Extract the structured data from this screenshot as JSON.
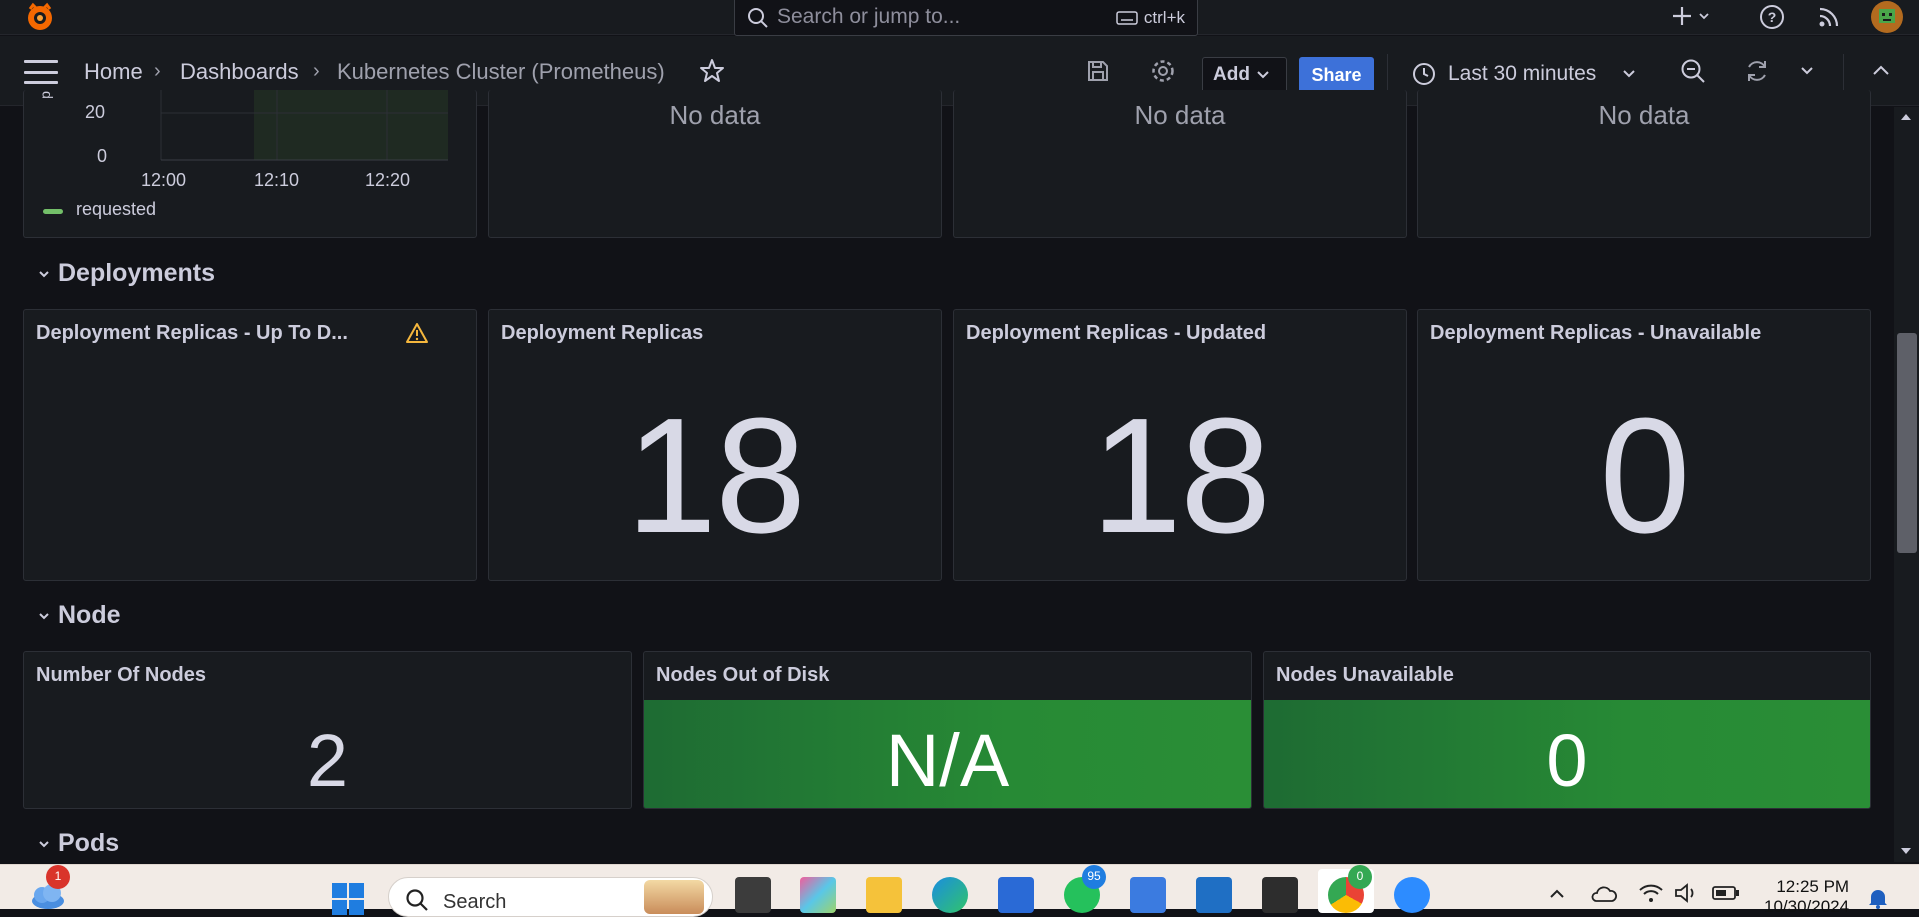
{
  "topbar": {
    "search_placeholder": "Search or jump to...",
    "search_shortcut": "ctrl+k"
  },
  "breadcrumb": {
    "home": "Home",
    "dashboards": "Dashboards",
    "current": "Kubernetes Cluster (Prometheus)"
  },
  "toolbar": {
    "add_label": "Add",
    "share_label": "Share",
    "time_range": "Last 30 minutes"
  },
  "top_row": {
    "chart_y_ticks": [
      "20",
      "0"
    ],
    "chart_x_ticks": [
      "12:00",
      "12:10",
      "12:20"
    ],
    "chart_legend": "requested",
    "no_data_1": "No data",
    "no_data_2": "No data",
    "no_data_3": "No data"
  },
  "deployments": {
    "row_title": "Deployments",
    "panels": [
      {
        "title": "Deployment Replicas - Up To D...",
        "value": ""
      },
      {
        "title": "Deployment Replicas",
        "value": "18"
      },
      {
        "title": "Deployment Replicas - Updated",
        "value": "18"
      },
      {
        "title": "Deployment Replicas - Unavailable",
        "value": "0"
      }
    ]
  },
  "node": {
    "row_title": "Node",
    "panels": [
      {
        "title": "Number Of Nodes",
        "value": "2"
      },
      {
        "title": "Nodes Out of Disk",
        "value": "N/A"
      },
      {
        "title": "Nodes Unavailable",
        "value": "0"
      }
    ]
  },
  "pods": {
    "row_title": "Pods"
  },
  "taskbar": {
    "search_label": "Search",
    "weather_badge": "1",
    "whatsapp_badge": "95",
    "chrome_badge": "0",
    "time": "12:25 PM",
    "date": "10/30/2024"
  },
  "colors": {
    "accent_blue": "#3d71d9",
    "stat_green": "#278a35",
    "warning": "#f5b73d",
    "legend_green": "#73bf69"
  }
}
